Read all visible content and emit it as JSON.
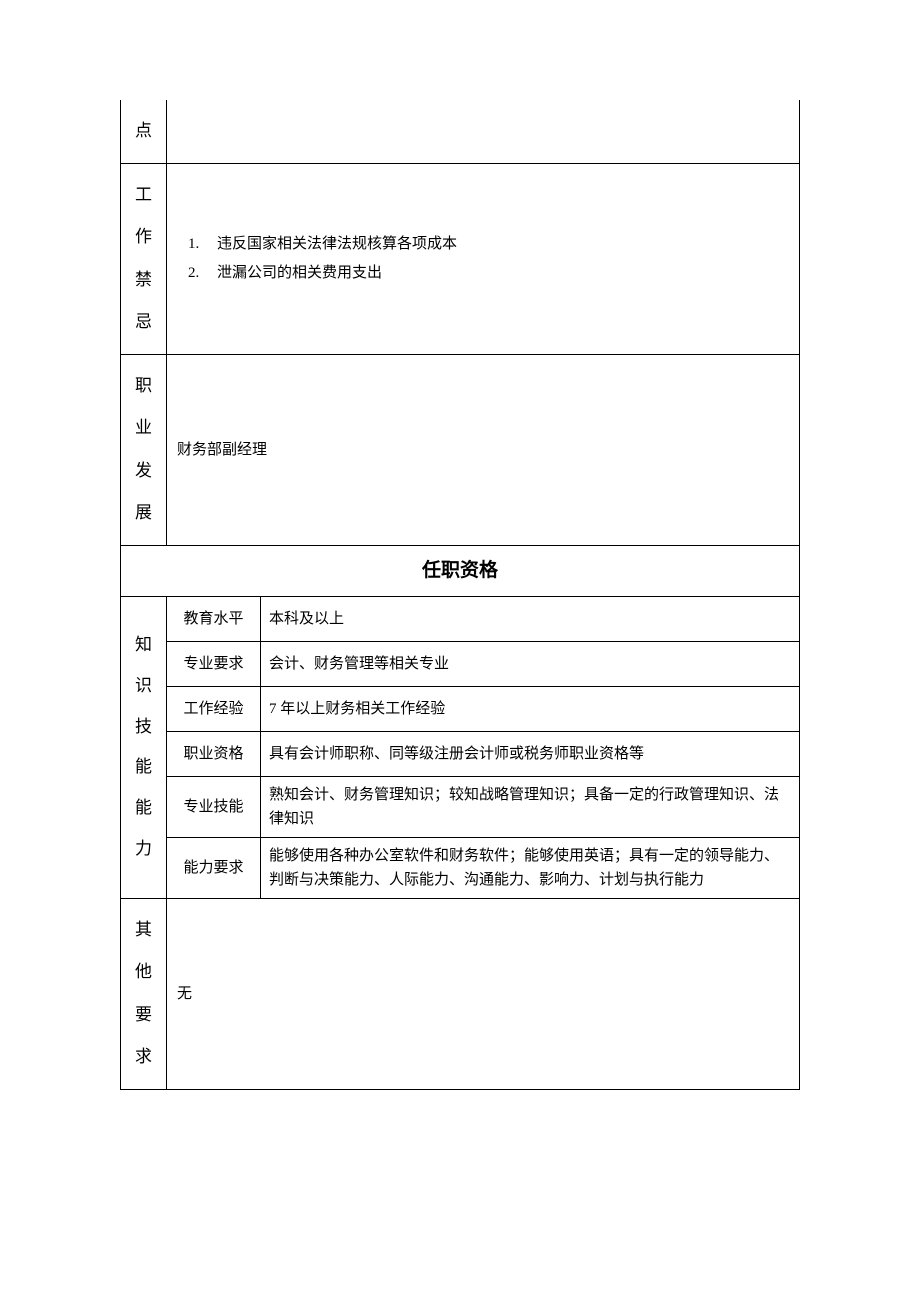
{
  "rows": {
    "partial_label": "点",
    "prohibitions": {
      "label_chars": [
        "工",
        "作",
        "禁",
        "忌"
      ],
      "items": [
        "违反国家相关法律法规核算各项成本",
        "泄漏公司的相关费用支出"
      ]
    },
    "career": {
      "label_chars": [
        "职",
        "业",
        "发",
        "展"
      ],
      "content": "财务部副经理"
    },
    "qualifications_header": "任职资格",
    "knowledge": {
      "label_chars": [
        "知",
        "识",
        "技",
        "能",
        "能",
        "力"
      ],
      "subrows": [
        {
          "label": "教育水平",
          "value": "本科及以上"
        },
        {
          "label": "专业要求",
          "value": "会计、财务管理等相关专业"
        },
        {
          "label": "工作经验",
          "value": "7 年以上财务相关工作经验"
        },
        {
          "label": "职业资格",
          "value": "具有会计师职称、同等级注册会计师或税务师职业资格等"
        },
        {
          "label": "专业技能",
          "value": "熟知会计、财务管理知识；较知战略管理知识；具备一定的行政管理知识、法律知识"
        },
        {
          "label": "能力要求",
          "value": "能够使用各种办公室软件和财务软件；能够使用英语；具有一定的领导能力、判断与决策能力、人际能力、沟通能力、影响力、计划与执行能力"
        }
      ]
    },
    "other": {
      "label_chars": [
        "其",
        "他",
        "要",
        "求"
      ],
      "content": "无"
    }
  }
}
